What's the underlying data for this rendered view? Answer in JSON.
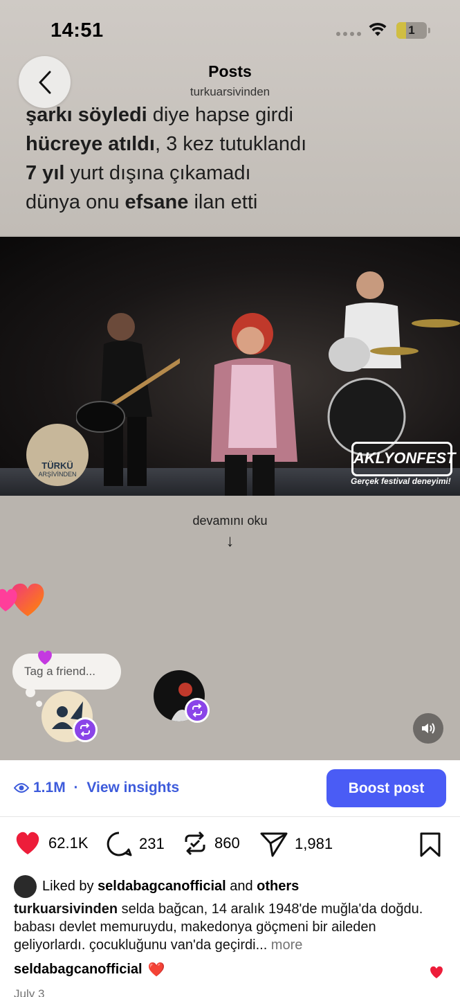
{
  "status_bar": {
    "time": "14:51",
    "battery": "1"
  },
  "header": {
    "title": "Posts",
    "username": "turkuarsivinden"
  },
  "overlay_caption": {
    "line1_bold": "şarkı söyledi",
    "line1_rest": " diye hapse girdi",
    "line2_bold": "hücreye atıldı",
    "line2_rest": ", 3 kez tutuklandı",
    "line3_bold": "7 yıl",
    "line3_rest": " yurt dışına çıkamadı",
    "line4_start": "dünya onu ",
    "line4_bold": "efsane",
    "line4_end": " ilan etti"
  },
  "photo": {
    "logo_line1": "TÜRKÜ",
    "logo_line2": "ARŞİVİNDEN",
    "watermark": "AKLYONFEST",
    "watermark_sub": "Gerçek festival deneyimi!"
  },
  "read_more": {
    "label": "devamını oku",
    "arrow": "↓"
  },
  "tag_friend": {
    "placeholder": "Tag a friend..."
  },
  "insights": {
    "views": "1.1M",
    "separator": " · ",
    "link": "View insights",
    "boost": "Boost post"
  },
  "actions": {
    "likes": "62.1K",
    "comments": "231",
    "reposts": "860",
    "shares": "1,981"
  },
  "liked_by": {
    "prefix": "Liked by ",
    "user": "seldabagcanofficial",
    "middle": " and ",
    "others": "others"
  },
  "caption": {
    "username": "turkuarsivinden",
    "text": " selda bağcan, 14 aralık 1948'de muğla'da doğdu. babası devlet memuruydu, makedonya göçmeni bir aileden geliyorlardı. çocukluğunu van'da geçirdi...",
    "more": " more"
  },
  "top_comment": {
    "username": "seldabagcanofficial",
    "emoji": "❤️"
  },
  "date": "July 3",
  "colors": {
    "accent": "#4a5cf5",
    "like": "#ed1d3a",
    "repost_badge": "#8a44e8"
  }
}
